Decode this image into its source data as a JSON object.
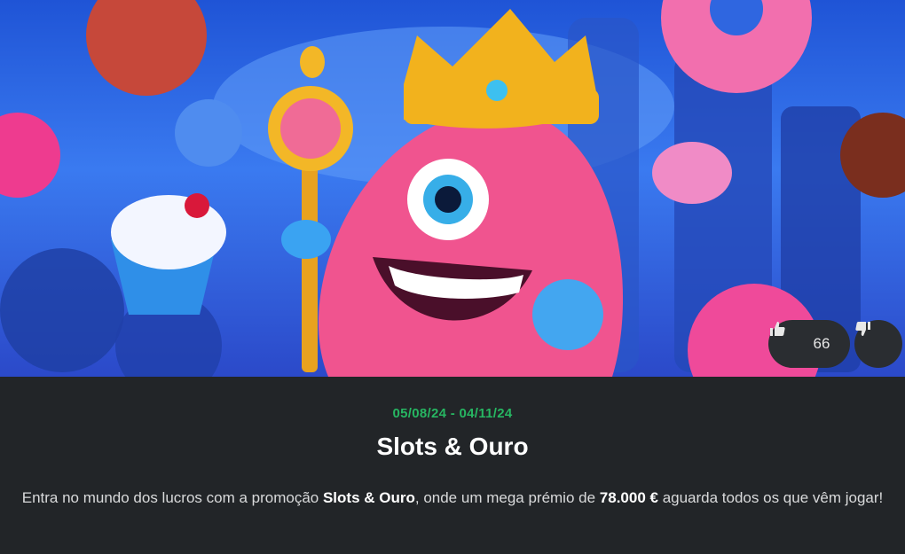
{
  "promo": {
    "dates": "05/08/24 - 04/11/24",
    "title": "Slots & Ouro",
    "desc_part1": "Entra no mundo dos lucros com a promoção ",
    "desc_bold1": "Slots & Ouro",
    "desc_part2": ", onde um mega prémio de ",
    "desc_bold2": "78.000 €",
    "desc_part3": " aguarda todos os que vêm jogar!"
  },
  "votes": {
    "like_count": "66",
    "like_icon": "thumbs-up-icon",
    "dislike_icon": "thumbs-down-icon"
  },
  "colors": {
    "date_green": "#27b662",
    "panel_bg": "#222528",
    "hero_blue": "#2f66e0"
  }
}
